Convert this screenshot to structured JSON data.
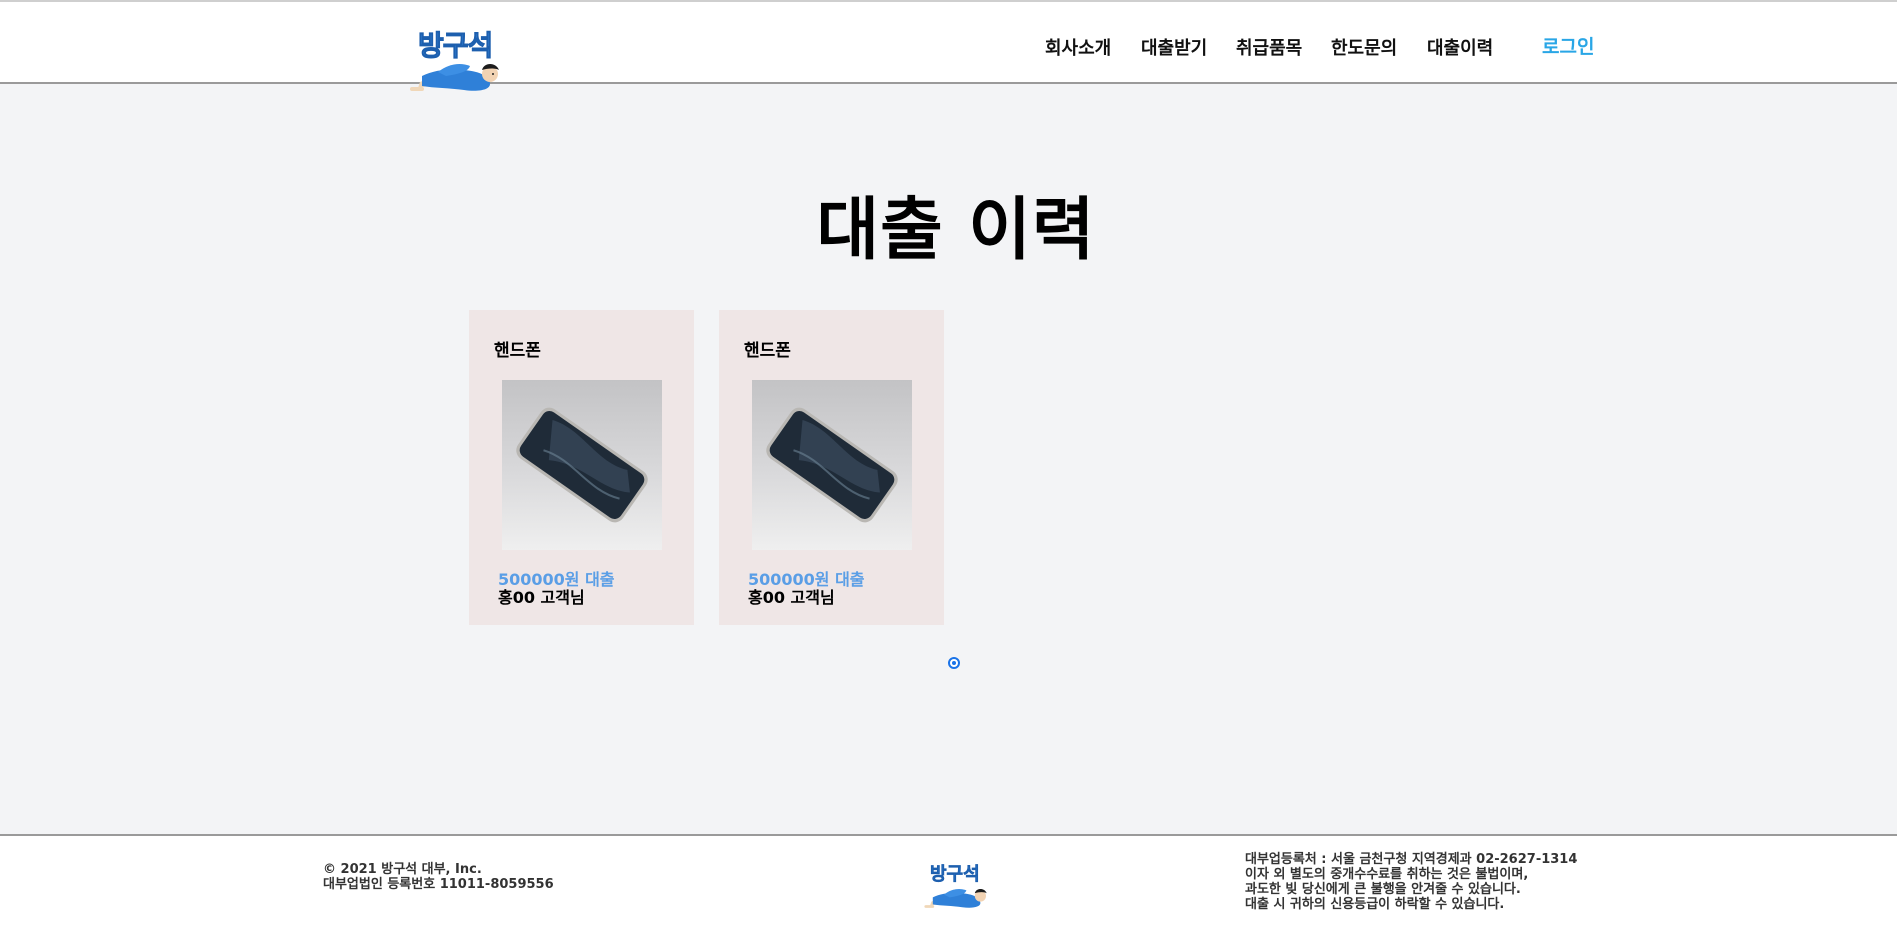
{
  "header": {
    "logo_text": "방구석",
    "nav": [
      "회사소개",
      "대출받기",
      "취급품목",
      "한도문의",
      "대출이력"
    ],
    "login_label": "로그인"
  },
  "main": {
    "title": "대출 이력",
    "cards": [
      {
        "category": "핸드폰",
        "amount": "500000원 대출",
        "customer": "홍00 고객님"
      },
      {
        "category": "핸드폰",
        "amount": "500000원 대출",
        "customer": "홍00 고객님"
      }
    ],
    "current_page": 1
  },
  "footer": {
    "logo_text": "방구석",
    "copyright": "© 2021 방구석 대부, Inc.",
    "registration": "대부업법인 등록번호 11011-8059556",
    "notice_lines": [
      "대부업등록처 : 서울 금천구청 지역경제과 02-2627-1314",
      "이자 외 별도의 중개수수료를 취하는 것은 불법이며,",
      "과도한 빚 당신에게 큰 불행을 안겨줄 수 있습니다.",
      "대출 시 귀하의 신용등급이 하락할 수 있습니다."
    ]
  },
  "colors": {
    "brand_blue": "#3a8ee6",
    "login_blue": "#29a6e6",
    "amount_blue": "#5a9ee6",
    "card_bg": "#efe6e6",
    "page_bg": "#f3f4f6"
  }
}
